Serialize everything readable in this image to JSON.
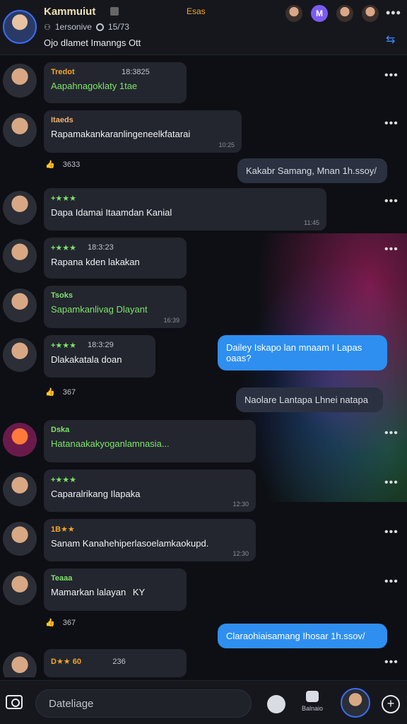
{
  "header": {
    "title": "Kammuiut",
    "tag": "Esas",
    "sub_text": "1ersonive",
    "sub_count": "15/73",
    "description": "Ojo dlamet Imanngs Ott"
  },
  "messages": [
    {
      "name": "Tredot",
      "time": "18:3825",
      "text": "Aapahnagoklaty 1tae",
      "name_color": "#f5a623",
      "text_color": "#7ee36b"
    },
    {
      "name": "Itaeds",
      "time": "",
      "text": "Rapamakankaranlingeneelkfatarai",
      "name_color": "#f0b070",
      "text_color": "#f0f1f4",
      "stamp": "10:25"
    },
    {
      "name": "+★★★",
      "time": "",
      "text": "Dapa Idamai Itaamdan Kanial",
      "name_color": "#7ee36b",
      "text_color": "#f0f1f4",
      "stamp": "11:45"
    },
    {
      "name": "+★★★",
      "time": "18:3:23",
      "text": "Rapana kden lakakan",
      "name_color": "#7ee36b",
      "text_color": "#f0f1f4"
    },
    {
      "name": "Tsoks",
      "time": "",
      "text": "Sapamkanlivag Dlayant",
      "name_color": "#7ee36b",
      "text_color": "#7ee36b",
      "stamp": "16:39"
    },
    {
      "name": "+★★★",
      "time": "18:3:29",
      "text": "Dlakakatala doan",
      "name_color": "#7ee36b",
      "text_color": "#f0f1f4"
    },
    {
      "name": "Dska",
      "time": "",
      "text": "Hatanaakakyoganlamnasia...",
      "name_color": "#7ee36b",
      "text_color": "#7ee36b"
    },
    {
      "name": "+★★★",
      "time": "",
      "text": "Caparalrikang Ilapaka",
      "name_color": "#7ee36b",
      "text_color": "#f0f1f4",
      "stamp": "12:30"
    },
    {
      "name": "1B★★",
      "time": "",
      "text": "Sanam Kanahehiperlasoelamkaokupd.",
      "name_color": "#f5a623",
      "text_color": "#f0f1f4",
      "stamp": "12:30"
    },
    {
      "name": "Teaaa",
      "time": "",
      "text": "Mamarkan lalayan",
      "name_color": "#7ee36b",
      "text_color": "#f0f1f4",
      "emoji_text": "KY"
    },
    {
      "name": "D★★ 60",
      "time": "",
      "text": "",
      "name_color": "#f5a623",
      "text_color": "#f0f1f4",
      "meta": "236"
    }
  ],
  "reactions": [
    {
      "count": "3633"
    },
    {
      "count": "367"
    },
    {
      "count": "367"
    }
  ],
  "outgoing": [
    "Kakabr Samang, Mnan 1h.ssoy/",
    "Dailey Iskapo lan mnaam I Lapas oaas?",
    "Naolare Lantapa Lhnei natapa",
    "Claraohiaisamang Ihosar 1h.ssov/"
  ],
  "composer": {
    "placeholder": "Dateliage",
    "sticker_label": "Balnaio"
  },
  "colors": {
    "accent": "#2e8ff0",
    "name_gold": "#f5a623",
    "name_green": "#7ee36b"
  }
}
